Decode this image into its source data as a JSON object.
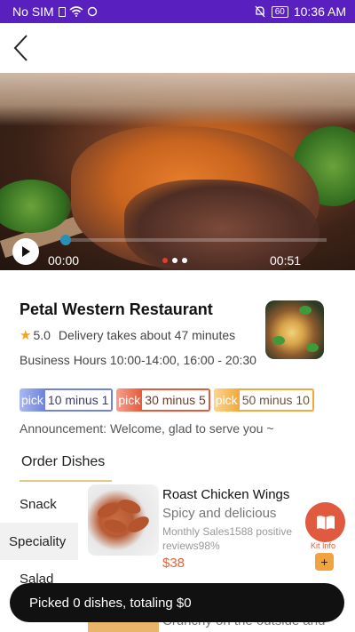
{
  "status_bar": {
    "carrier": "No SIM",
    "battery": "60",
    "time": "10:36 AM"
  },
  "video": {
    "current_time": "00:00",
    "duration": "00:51",
    "slide_count": 3,
    "active_slide": 1
  },
  "restaurant": {
    "name": "Petal Western Restaurant",
    "rating": "5.0",
    "delivery": "Delivery takes about 47 minutes",
    "hours": "Business Hours 10:00-14:00, 16:00 - 20:30",
    "promotions": [
      {
        "tag": "pick",
        "text": "10 minus 1"
      },
      {
        "tag": "pick",
        "text": "30 minus 5"
      },
      {
        "tag": "pick",
        "text": "50 minus 10"
      }
    ],
    "announcement": "Announcement: Welcome, glad to serve you ~"
  },
  "order_tab": "Order Dishes",
  "categories": [
    "Snack",
    "Speciality",
    "Salad"
  ],
  "active_category": "Speciality",
  "dish": {
    "name": "Roast Chicken Wings",
    "description": "Spicy and delicious",
    "sales": "Monthly Sales1588 positive reviews98%",
    "price": "$38",
    "add": "+"
  },
  "next_dish_text": "Crunchy on the outside and",
  "kit_info": "Kit Info",
  "cart": "Picked 0 dishes, totaling $0",
  "colors": {
    "status_bar": "#5a1fbf",
    "price": "#e2623a",
    "kit_info": "#e05a3f",
    "add_button": "#f0a33e",
    "cart_bar": "#111111"
  }
}
